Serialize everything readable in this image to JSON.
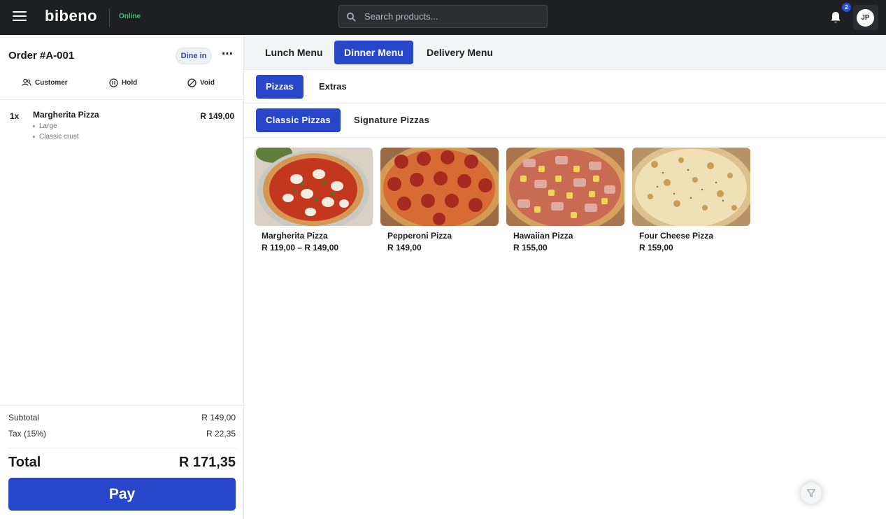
{
  "app": {
    "logo_text": "bibeno",
    "status": "Online",
    "search_placeholder": "Search products...",
    "notification_count": "2",
    "avatar_initials": "JP"
  },
  "order": {
    "title": "Order #A-001",
    "service_type": "Dine in",
    "more_label": "⋯",
    "actions": {
      "customer": "Customer",
      "hold": "Hold",
      "void": "Void"
    },
    "items": [
      {
        "qty": "1x",
        "name": "Margherita Pizza",
        "price": "R 149,00",
        "modifiers": [
          "Large",
          "Classic crust"
        ]
      }
    ],
    "subtotal_label": "Subtotal",
    "subtotal_value": "R 149,00",
    "tax_label": "Tax (15%)",
    "tax_value": "R 22,35",
    "total_label": "Total",
    "total_value": "R 171,35",
    "pay_label": "Pay"
  },
  "menus": {
    "tabs": [
      "Lunch Menu",
      "Dinner Menu",
      "Delivery Menu"
    ],
    "active_tab": "Dinner Menu",
    "categories": [
      "Pizzas",
      "Extras"
    ],
    "active_category": "Pizzas",
    "subcategories": [
      "Classic Pizzas",
      "Signature Pizzas"
    ],
    "active_subcategory": "Classic Pizzas"
  },
  "products": [
    {
      "name": "Margherita Pizza",
      "price": "R 119,00 – R 149,00",
      "image": "margherita-pizza-photo"
    },
    {
      "name": "Pepperoni Pizza",
      "price": "R 149,00",
      "image": "pepperoni-pizza-photo"
    },
    {
      "name": "Hawaiian Pizza",
      "price": "R 155,00",
      "image": "hawaiian-pizza-photo"
    },
    {
      "name": "Four Cheese Pizza",
      "price": "R 159,00",
      "image": "four-cheese-pizza-photo"
    }
  ],
  "colors": {
    "topbar": "#1e1f22",
    "accent": "#2846c9",
    "status_online": "#41c46a"
  }
}
